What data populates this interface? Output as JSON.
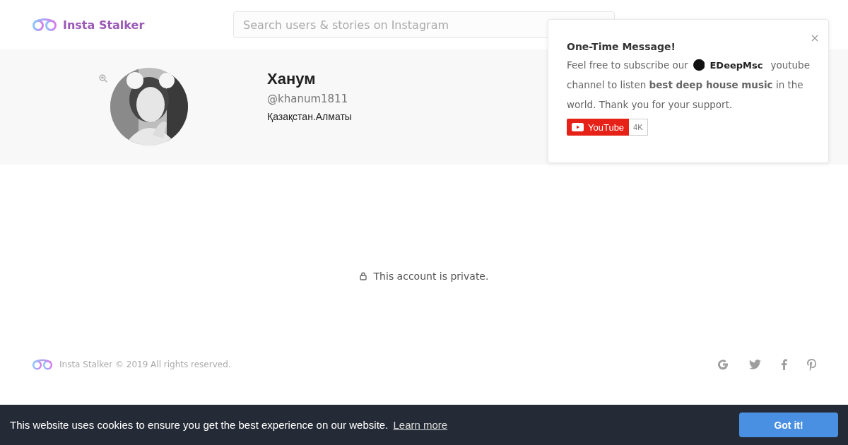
{
  "header": {
    "brand": "Insta Stalker",
    "search": {
      "placeholder": "Search users & stories on Instagram"
    }
  },
  "profile": {
    "name": "Ханум",
    "username": "@khanum1811",
    "bio": "Қазақстан.Алматы"
  },
  "content": {
    "private_message": "This account is private."
  },
  "footer": {
    "copyright": "Insta Stalker © 2019 All rights reserved."
  },
  "popup": {
    "title": "One-Time Message!",
    "text_before": "Feel free to subscribe our",
    "channel": "EDeepMsc",
    "text_mid": "youtube",
    "text_after": "channel to listen **best deep house music** in the world. Thank you for your support.",
    "youtube_button": "YouTube",
    "subscriber_count": "4K"
  },
  "cookie_bar": {
    "message": "This website uses cookies to ensure you get the best experience on our website.",
    "link": "Learn more",
    "button": "Got it!"
  }
}
